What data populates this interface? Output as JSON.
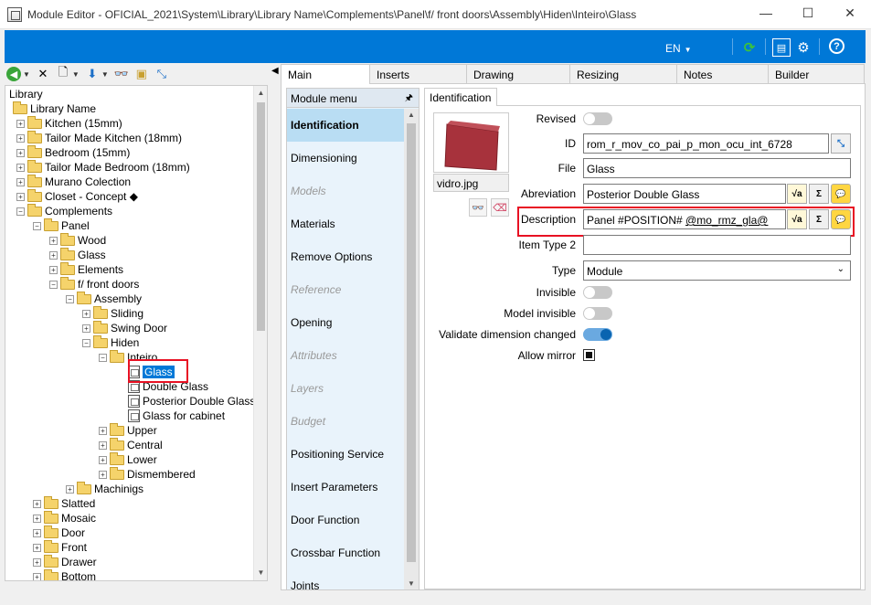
{
  "window": {
    "title": "Module Editor - OFICIAL_2021\\System\\Library\\Library Name\\Complements\\Panel\\f/ front doors\\Assembly\\Hiden\\Inteiro\\Glass",
    "minimize": "—",
    "maximize": "☐",
    "close": "✕"
  },
  "topbar": {
    "language": "EN",
    "language_caret": "▼"
  },
  "tree": {
    "items": [
      {
        "label": "Library",
        "level": 0,
        "icon": "none"
      },
      {
        "label": "Library Name",
        "level": 1,
        "icon": "folder-open"
      },
      {
        "label": "Kitchen (15mm)",
        "level": 2,
        "icon": "folder"
      },
      {
        "label": "Tailor Made Kitchen (18mm)",
        "level": 2,
        "icon": "folder"
      },
      {
        "label": "Bedroom (15mm)",
        "level": 2,
        "icon": "folder"
      },
      {
        "label": "Tailor Made Bedroom (18mm)",
        "level": 2,
        "icon": "folder"
      },
      {
        "label": "Murano Colection",
        "level": 2,
        "icon": "folder"
      },
      {
        "label": "Closet - Concept ◆",
        "level": 2,
        "icon": "folder"
      },
      {
        "label": "Complements",
        "level": 2,
        "icon": "folder-open"
      },
      {
        "label": "Panel",
        "level": 3,
        "icon": "folder-open"
      },
      {
        "label": "Wood",
        "level": 4,
        "icon": "folder"
      },
      {
        "label": "Glass",
        "level": 4,
        "icon": "folder"
      },
      {
        "label": "Elements",
        "level": 4,
        "icon": "folder"
      },
      {
        "label": "f/ front doors",
        "level": 4,
        "icon": "folder-open"
      },
      {
        "label": "Assembly",
        "level": 5,
        "icon": "folder-open"
      },
      {
        "label": "Sliding",
        "level": 6,
        "icon": "folder"
      },
      {
        "label": "Swing Door",
        "level": 6,
        "icon": "folder"
      },
      {
        "label": "Hiden",
        "level": 6,
        "icon": "folder-open"
      },
      {
        "label": "Inteiro",
        "level": 7,
        "icon": "folder-open"
      },
      {
        "label": "Glass",
        "level": 8,
        "icon": "doc",
        "selected": true
      },
      {
        "label": "Double Glass",
        "level": 8,
        "icon": "doc"
      },
      {
        "label": "Posterior Double Glass",
        "level": 8,
        "icon": "doc"
      },
      {
        "label": "Glass for cabinet",
        "level": 8,
        "icon": "doc"
      },
      {
        "label": "Upper",
        "level": 7,
        "icon": "folder"
      },
      {
        "label": "Central",
        "level": 7,
        "icon": "folder"
      },
      {
        "label": "Lower",
        "level": 7,
        "icon": "folder"
      },
      {
        "label": "Dismembered",
        "level": 7,
        "icon": "folder"
      },
      {
        "label": "Machinigs",
        "level": 5,
        "icon": "folder"
      },
      {
        "label": "Slatted",
        "level": 3,
        "icon": "folder"
      },
      {
        "label": "Mosaic",
        "level": 3,
        "icon": "folder"
      },
      {
        "label": "Door",
        "level": 3,
        "icon": "folder"
      },
      {
        "label": "Front",
        "level": 3,
        "icon": "folder"
      },
      {
        "label": "Drawer",
        "level": 3,
        "icon": "folder"
      },
      {
        "label": "Bottom",
        "level": 3,
        "icon": "folder"
      }
    ]
  },
  "tabs": [
    "Main",
    "Inserts",
    "Drawing",
    "Resizing",
    "Notes",
    "Builder"
  ],
  "module_menu": {
    "title": "Module menu",
    "items": [
      {
        "label": "Identification",
        "state": "active"
      },
      {
        "label": "Dimensioning",
        "state": "normal"
      },
      {
        "label": "Models",
        "state": "disabled"
      },
      {
        "label": "Materials",
        "state": "normal"
      },
      {
        "label": "Remove Options",
        "state": "normal"
      },
      {
        "label": "Reference",
        "state": "disabled"
      },
      {
        "label": "Opening",
        "state": "normal"
      },
      {
        "label": "Attributes",
        "state": "disabled"
      },
      {
        "label": "Layers",
        "state": "disabled"
      },
      {
        "label": "Budget",
        "state": "disabled"
      },
      {
        "label": "Positioning Service",
        "state": "normal"
      },
      {
        "label": "Insert Parameters",
        "state": "normal"
      },
      {
        "label": "Door Function",
        "state": "normal"
      },
      {
        "label": "Crossbar Function",
        "state": "normal"
      },
      {
        "label": "Joints",
        "state": "normal"
      }
    ]
  },
  "identification": {
    "tab_label": "Identification",
    "image_caption": "vidro.jpg",
    "image_color": "#a7323c",
    "labels": {
      "revised": "Revised",
      "id": "ID",
      "file": "File",
      "abreviation": "Abreviation",
      "description": "Description",
      "item_type_2": "Item Type 2",
      "type": "Type",
      "invisible": "Invisible",
      "model_invisible": "Model invisible",
      "validate_dimension_changed": "Validate dimension changed",
      "allow_mirror": "Allow mirror"
    },
    "values": {
      "id": "rom_r_mov_co_pai_p_mon_ocu_int_6728",
      "file": "Glass",
      "abreviation": "Posterior Double Glass",
      "description_prefix": "Panel #POSITION# ",
      "description_var": "@mo_rmz_gla@",
      "item_type_2": "",
      "type": "Module"
    },
    "toggles": {
      "revised": false,
      "invisible": false,
      "model_invisible": false,
      "validate_dimension_changed": true,
      "allow_mirror": true
    },
    "sigma": "Σ"
  },
  "colors": {
    "accent": "#0078d7",
    "highlight": "#e81123",
    "menu_active": "#b9ddf3"
  }
}
